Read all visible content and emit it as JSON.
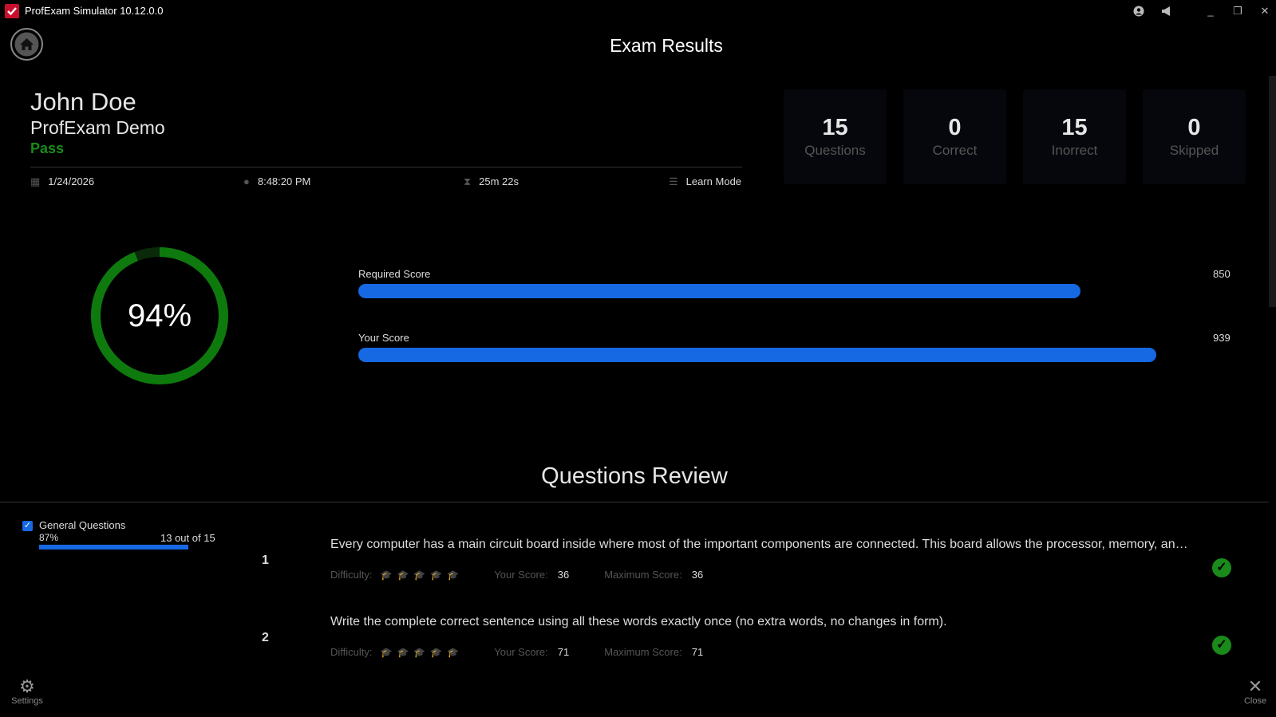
{
  "window": {
    "title": "ProfExam Simulator 10.12.0.0"
  },
  "header": {
    "title": "Exam Results"
  },
  "candidate": {
    "name": "John Doe",
    "exam": "ProfExam Demo",
    "result": "Pass"
  },
  "meta": {
    "date": "1/24/2026",
    "time": "8:48:20 PM",
    "duration": "25m 22s",
    "mode": "Learn Mode"
  },
  "stats": [
    {
      "value": "15",
      "label": "Questions"
    },
    {
      "value": "0",
      "label": "Correct"
    },
    {
      "value": "15",
      "label": "Inorrect"
    },
    {
      "value": "0",
      "label": "Skipped"
    }
  ],
  "score": {
    "percent_label": "94%",
    "percent": 94,
    "required_label": "Required Score",
    "required_value": "850",
    "required_fraction": 0.905,
    "your_label": "Your Score",
    "your_value": "939",
    "your_fraction": 1.0
  },
  "review": {
    "title": "Questions Review",
    "category": {
      "name": "General Questions",
      "percent": "87%",
      "count": "13 out of 15",
      "fraction": 0.87
    },
    "questions": [
      {
        "number": "1",
        "text": "Every computer has a main circuit board inside where most of the important components are connected. This board allows the processor, memory, and other parts to communicate.",
        "difficulty_label": "Difficulty:",
        "difficulty": 1,
        "your_score_label": "Your Score:",
        "your_score": "36",
        "max_score_label": "Maximum Score:",
        "max_score": "36"
      },
      {
        "number": "2",
        "text": "Write the complete correct sentence using all these words exactly once (no extra words, no changes in form).",
        "difficulty_label": "Difficulty:",
        "difficulty": 2,
        "your_score_label": "Your Score:",
        "your_score": "71",
        "max_score_label": "Maximum Score:",
        "max_score": "71"
      }
    ]
  },
  "footer": {
    "settings_label": "Settings",
    "close_label": "Close"
  },
  "colors": {
    "accent": "#1668e3",
    "pass": "#1a8a1a",
    "background": "#000000"
  },
  "icons": [
    "app-logo-icon",
    "home-icon",
    "user-icon",
    "megaphone-icon",
    "calendar-icon",
    "clock-icon",
    "hourglass-icon",
    "mode-icon",
    "check-icon",
    "gear-icon",
    "close-icon"
  ]
}
